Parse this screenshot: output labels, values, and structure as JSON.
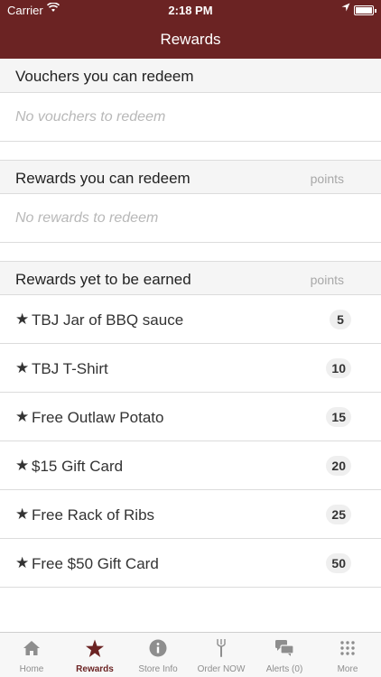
{
  "status": {
    "carrier": "Carrier",
    "time": "2:18 PM"
  },
  "nav": {
    "title": "Rewards"
  },
  "vouchers": {
    "header": "Vouchers you can redeem",
    "empty": "No vouchers to redeem"
  },
  "redeemable": {
    "header": "Rewards you can redeem",
    "points_label": "points",
    "empty": "No rewards to redeem"
  },
  "to_earn": {
    "header": "Rewards yet to be earned",
    "points_label": "points",
    "items": [
      {
        "star": "★",
        "name": "TBJ Jar of BBQ sauce",
        "points": "5"
      },
      {
        "star": "★",
        "name": "TBJ T-Shirt",
        "points": "10"
      },
      {
        "star": "★",
        "name": "Free Outlaw Potato",
        "points": "15"
      },
      {
        "star": "★",
        "name": "$15 Gift Card",
        "points": "20"
      },
      {
        "star": "★",
        "name": "Free Rack of Ribs",
        "points": "25"
      },
      {
        "star": "★",
        "name": "Free $50 Gift Card",
        "points": "50"
      }
    ]
  },
  "tabs": [
    {
      "label": "Home",
      "icon": "home-icon",
      "active": false
    },
    {
      "label": "Rewards",
      "icon": "star-icon",
      "active": true
    },
    {
      "label": "Store Info",
      "icon": "info-icon",
      "active": false
    },
    {
      "label": "Order NOW",
      "icon": "fork-icon",
      "active": false
    },
    {
      "label": "Alerts (0)",
      "icon": "chat-icon",
      "active": false
    },
    {
      "label": "More",
      "icon": "grid-icon",
      "active": false
    }
  ],
  "colors": {
    "brand": "#6b2323",
    "tab_inactive": "#8e8e8e"
  }
}
